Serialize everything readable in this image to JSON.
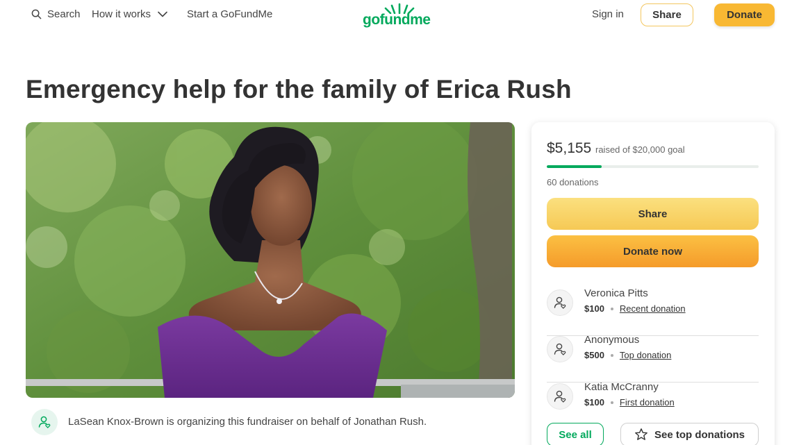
{
  "header": {
    "search_label": "Search",
    "how_label": "How it works",
    "start_label": "Start a GoFundMe",
    "logo_text": "gofundme",
    "signin_label": "Sign in",
    "share_label": "Share",
    "donate_label": "Donate"
  },
  "campaign": {
    "title": "Emergency help for the family of Erica Rush",
    "organizer_text": "LaSean Knox-Brown is organizing this fundraiser on behalf of Jonathan Rush."
  },
  "card": {
    "raised": "$5,155",
    "goal_text": "raised of $20,000 goal",
    "progress_fraction": 0.2578,
    "donations_text": "60 donations",
    "share_label": "Share",
    "donate_now_label": "Donate now",
    "donors": [
      {
        "name": "Veronica Pitts",
        "amount": "$100",
        "type": "Recent donation"
      },
      {
        "name": "Anonymous",
        "amount": "$500",
        "type": "Top donation"
      },
      {
        "name": "Katia McCranny",
        "amount": "$100",
        "type": "First donation"
      }
    ],
    "see_all_label": "See all",
    "see_top_label": "See top donations"
  },
  "colors": {
    "brand_green": "#02a95c",
    "donate_orange": "#f59b2a",
    "share_yellow": "#f6c955"
  },
  "icons": [
    "search-icon",
    "chevron-down-icon",
    "logo-sun-icon",
    "user-heart-icon",
    "star-icon"
  ]
}
